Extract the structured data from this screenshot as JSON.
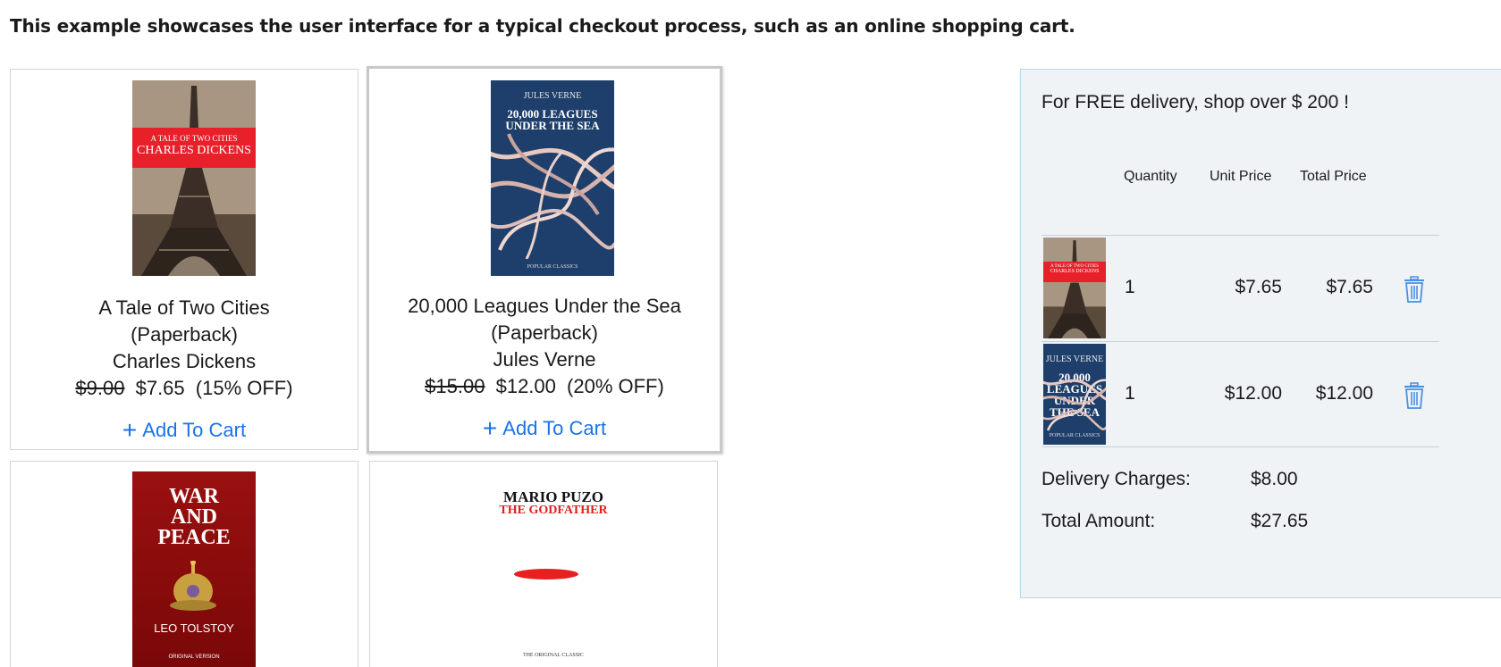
{
  "intro": "This example showcases the user interface for a typical checkout process, such as an online shopping cart.",
  "products": [
    {
      "title": "A Tale of Two Cities",
      "format": "(Paperback)",
      "author": "Charles Dickens",
      "old_price": "$9.00",
      "price": "$7.65",
      "discount": "(15% OFF)",
      "add_label": "Add To Cart",
      "cover": {
        "line1": "A TALE OF TWO CITIES",
        "line2": "CHARLES DICKENS"
      }
    },
    {
      "title": "20,000 Leagues Under the Sea",
      "format": "(Paperback)",
      "author": "Jules Verne",
      "old_price": "$15.00",
      "price": "$12.00",
      "discount": "(20% OFF)",
      "add_label": "Add To Cart",
      "cover": {
        "author": "JULES VERNE",
        "title1": "20,000 LEAGUES",
        "title2": "UNDER THE SEA",
        "footer": "POPULAR CLASSICS"
      }
    },
    {
      "cover": {
        "title1": "WAR",
        "title2": "AND",
        "title3": "PEACE",
        "author": "LEO TOLSTOY",
        "footer": "ORIGINAL VERSION"
      }
    },
    {
      "cover": {
        "author": "MARIO PUZO",
        "title": "THE GODFATHER",
        "footer": "THE ORIGINAL CLASSIC"
      }
    }
  ],
  "cart": {
    "banner": "For FREE delivery, shop over $ 200 !",
    "headers": {
      "quantity": "Quantity",
      "unit_price": "Unit Price",
      "total_price": "Total Price"
    },
    "items": [
      {
        "quantity": "1",
        "unit_price": "$7.65",
        "total_price": "$7.65"
      },
      {
        "quantity": "1",
        "unit_price": "$12.00",
        "total_price": "$12.00"
      }
    ],
    "delivery_label": "Delivery Charges:",
    "delivery_value": "$8.00",
    "total_label": "Total Amount:",
    "total_value": "$27.65"
  },
  "colors": {
    "link": "#1a73e8",
    "panel_bg": "#eff3f6",
    "panel_border": "#b7d6e9"
  },
  "icons": {
    "add": "plus-icon",
    "remove": "trash-icon"
  }
}
